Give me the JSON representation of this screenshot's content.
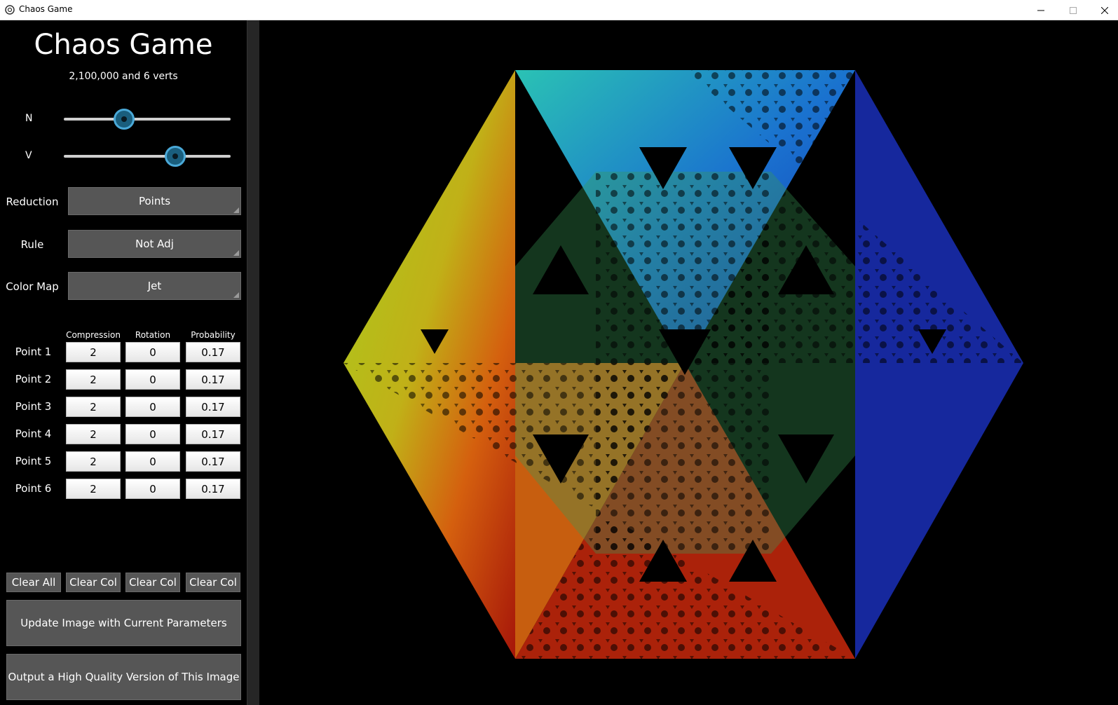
{
  "window": {
    "title": "Chaos Game"
  },
  "panel": {
    "title": "Chaos Game",
    "subtitle": "2,100,000 and 6 verts",
    "sliders": [
      {
        "label": "N",
        "value": 0.36
      },
      {
        "label": "V",
        "value": 0.67
      }
    ],
    "dropdowns": [
      {
        "label": "Reduction",
        "value": "Points"
      },
      {
        "label": "Rule",
        "value": "Not Adj"
      },
      {
        "label": "Color Map",
        "value": "Jet"
      }
    ],
    "columns": [
      "Compression",
      "Rotation",
      "Probability"
    ],
    "points": [
      {
        "label": "Point 1",
        "compression": "2",
        "rotation": "0",
        "probability": "0.17"
      },
      {
        "label": "Point 2",
        "compression": "2",
        "rotation": "0",
        "probability": "0.17"
      },
      {
        "label": "Point 3",
        "compression": "2",
        "rotation": "0",
        "probability": "0.17"
      },
      {
        "label": "Point 4",
        "compression": "2",
        "rotation": "0",
        "probability": "0.17"
      },
      {
        "label": "Point 5",
        "compression": "2",
        "rotation": "0",
        "probability": "0.17"
      },
      {
        "label": "Point 6",
        "compression": "2",
        "rotation": "0",
        "probability": "0.17"
      }
    ],
    "buttons": {
      "clear_all": "Clear All",
      "clear_col_1": "Clear Col",
      "clear_col_2": "Clear Col",
      "clear_col_3": "Clear Col",
      "update": "Update Image with Current Parameters",
      "output": "Output a High Quality Version of This Image"
    }
  },
  "colors": {
    "panel_bg": "#000000",
    "button_bg": "#565656",
    "slider_thumb": "#4aa9d8",
    "canvas_bg": "#000000"
  }
}
